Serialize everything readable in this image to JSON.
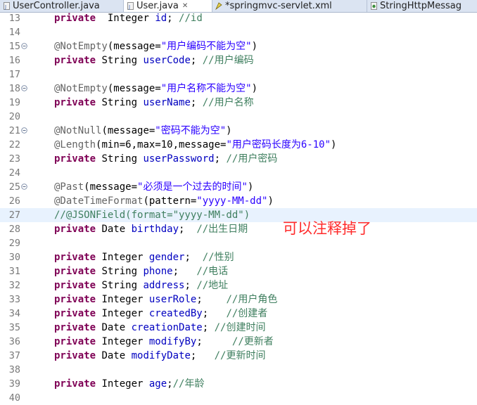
{
  "tabs": [
    {
      "label": "UserController.java",
      "active": false,
      "icon": "java-file-icon"
    },
    {
      "label": "User.java",
      "active": true,
      "icon": "java-file-icon",
      "close": "✕"
    },
    {
      "label": "*springmvc-servlet.xml",
      "active": false,
      "icon": "xml-file-icon"
    },
    {
      "label": "StringHttpMessag",
      "active": false,
      "icon": "class-file-icon"
    }
  ],
  "lines": [
    {
      "n": "13",
      "fold": false,
      "highlight": false,
      "tokens": [
        [
          "kw",
          "private"
        ],
        [
          "",
          "  Integer "
        ],
        [
          "field",
          "id"
        ],
        [
          "",
          "; "
        ],
        [
          "cm",
          "//id"
        ]
      ]
    },
    {
      "n": "14",
      "fold": false,
      "highlight": false,
      "tokens": []
    },
    {
      "n": "15",
      "fold": true,
      "highlight": false,
      "tokens": [
        [
          "ann",
          "@NotEmpty"
        ],
        [
          "",
          "(message="
        ],
        [
          "str",
          "\"用户编码不能为空\""
        ],
        [
          "",
          ")"
        ]
      ]
    },
    {
      "n": "16",
      "fold": false,
      "highlight": false,
      "tokens": [
        [
          "kw",
          "private"
        ],
        [
          "",
          " String "
        ],
        [
          "field",
          "userCode"
        ],
        [
          "",
          "; "
        ],
        [
          "cm",
          "//用户编码"
        ]
      ]
    },
    {
      "n": "17",
      "fold": false,
      "highlight": false,
      "tokens": []
    },
    {
      "n": "18",
      "fold": true,
      "highlight": false,
      "tokens": [
        [
          "ann",
          "@NotEmpty"
        ],
        [
          "",
          "(message="
        ],
        [
          "str",
          "\"用户名称不能为空\""
        ],
        [
          "",
          ")"
        ]
      ]
    },
    {
      "n": "19",
      "fold": false,
      "highlight": false,
      "tokens": [
        [
          "kw",
          "private"
        ],
        [
          "",
          " String "
        ],
        [
          "field",
          "userName"
        ],
        [
          "",
          "; "
        ],
        [
          "cm",
          "//用户名称"
        ]
      ]
    },
    {
      "n": "20",
      "fold": false,
      "highlight": false,
      "tokens": []
    },
    {
      "n": "21",
      "fold": true,
      "highlight": false,
      "tokens": [
        [
          "ann",
          "@NotNull"
        ],
        [
          "",
          "(message="
        ],
        [
          "str",
          "\"密码不能为空\""
        ],
        [
          "",
          ")"
        ]
      ]
    },
    {
      "n": "22",
      "fold": false,
      "highlight": false,
      "tokens": [
        [
          "ann",
          "@Length"
        ],
        [
          "",
          "(min=6,max=10,message="
        ],
        [
          "str",
          "\"用户密码长度为6-10\""
        ],
        [
          "",
          ")"
        ]
      ]
    },
    {
      "n": "23",
      "fold": false,
      "highlight": false,
      "tokens": [
        [
          "kw",
          "private"
        ],
        [
          "",
          " String "
        ],
        [
          "field",
          "userPassword"
        ],
        [
          "",
          "; "
        ],
        [
          "cm",
          "//用户密码"
        ]
      ]
    },
    {
      "n": "24",
      "fold": false,
      "highlight": false,
      "tokens": []
    },
    {
      "n": "25",
      "fold": true,
      "highlight": false,
      "tokens": [
        [
          "ann",
          "@Past"
        ],
        [
          "",
          "(message="
        ],
        [
          "str",
          "\"必须是一个过去的时间\""
        ],
        [
          "",
          ")"
        ]
      ]
    },
    {
      "n": "26",
      "fold": false,
      "highlight": false,
      "tokens": [
        [
          "ann",
          "@DateTimeFormat"
        ],
        [
          "",
          "(pattern="
        ],
        [
          "str",
          "\"yyyy-MM-dd\""
        ],
        [
          "",
          ")"
        ]
      ]
    },
    {
      "n": "27",
      "fold": false,
      "highlight": true,
      "tokens": [
        [
          "cm",
          "//@JSONField(format=\"yyyy-MM-dd\")"
        ]
      ]
    },
    {
      "n": "28",
      "fold": false,
      "highlight": false,
      "tokens": [
        [
          "kw",
          "private"
        ],
        [
          "",
          " Date "
        ],
        [
          "field",
          "birthday"
        ],
        [
          "",
          ";  "
        ],
        [
          "cm",
          "//出生日期"
        ]
      ]
    },
    {
      "n": "29",
      "fold": false,
      "highlight": false,
      "tokens": []
    },
    {
      "n": "30",
      "fold": false,
      "highlight": false,
      "tokens": [
        [
          "kw",
          "private"
        ],
        [
          "",
          " Integer "
        ],
        [
          "field",
          "gender"
        ],
        [
          "",
          ";  "
        ],
        [
          "cm",
          "//性别"
        ]
      ]
    },
    {
      "n": "31",
      "fold": false,
      "highlight": false,
      "tokens": [
        [
          "kw",
          "private"
        ],
        [
          "",
          " String "
        ],
        [
          "field",
          "phone"
        ],
        [
          "",
          ";   "
        ],
        [
          "cm",
          "//电话"
        ]
      ]
    },
    {
      "n": "32",
      "fold": false,
      "highlight": false,
      "tokens": [
        [
          "kw",
          "private"
        ],
        [
          "",
          " String "
        ],
        [
          "field",
          "address"
        ],
        [
          "",
          "; "
        ],
        [
          "cm",
          "//地址"
        ]
      ]
    },
    {
      "n": "33",
      "fold": false,
      "highlight": false,
      "tokens": [
        [
          "kw",
          "private"
        ],
        [
          "",
          " Integer "
        ],
        [
          "field",
          "userRole"
        ],
        [
          "",
          ";    "
        ],
        [
          "cm",
          "//用户角色"
        ]
      ]
    },
    {
      "n": "34",
      "fold": false,
      "highlight": false,
      "tokens": [
        [
          "kw",
          "private"
        ],
        [
          "",
          " Integer "
        ],
        [
          "field",
          "createdBy"
        ],
        [
          "",
          ";   "
        ],
        [
          "cm",
          "//创建者"
        ]
      ]
    },
    {
      "n": "35",
      "fold": false,
      "highlight": false,
      "tokens": [
        [
          "kw",
          "private"
        ],
        [
          "",
          " Date "
        ],
        [
          "field",
          "creationDate"
        ],
        [
          "",
          "; "
        ],
        [
          "cm",
          "//创建时间"
        ]
      ]
    },
    {
      "n": "36",
      "fold": false,
      "highlight": false,
      "tokens": [
        [
          "kw",
          "private"
        ],
        [
          "",
          " Integer "
        ],
        [
          "field",
          "modifyBy"
        ],
        [
          "",
          ";     "
        ],
        [
          "cm",
          "//更新者"
        ]
      ]
    },
    {
      "n": "37",
      "fold": false,
      "highlight": false,
      "tokens": [
        [
          "kw",
          "private"
        ],
        [
          "",
          " Date "
        ],
        [
          "field",
          "modifyDate"
        ],
        [
          "",
          ";   "
        ],
        [
          "cm",
          "//更新时间"
        ]
      ]
    },
    {
      "n": "38",
      "fold": false,
      "highlight": false,
      "tokens": []
    },
    {
      "n": "39",
      "fold": false,
      "highlight": false,
      "tokens": [
        [
          "kw",
          "private"
        ],
        [
          "",
          " Integer "
        ],
        [
          "field",
          "age"
        ],
        [
          "",
          ";"
        ],
        [
          "cm",
          "//年龄"
        ]
      ]
    },
    {
      "n": "40",
      "fold": false,
      "highlight": false,
      "tokens": []
    }
  ],
  "annotation_note": "可以注释掉了",
  "colors": {
    "keyword": "#7f0055",
    "field": "#0000c0",
    "comment": "#3f7f5f",
    "annotation": "#646464",
    "string": "#2a00ff",
    "note": "#ff2b2b",
    "highlight": "#e8f2fe"
  }
}
